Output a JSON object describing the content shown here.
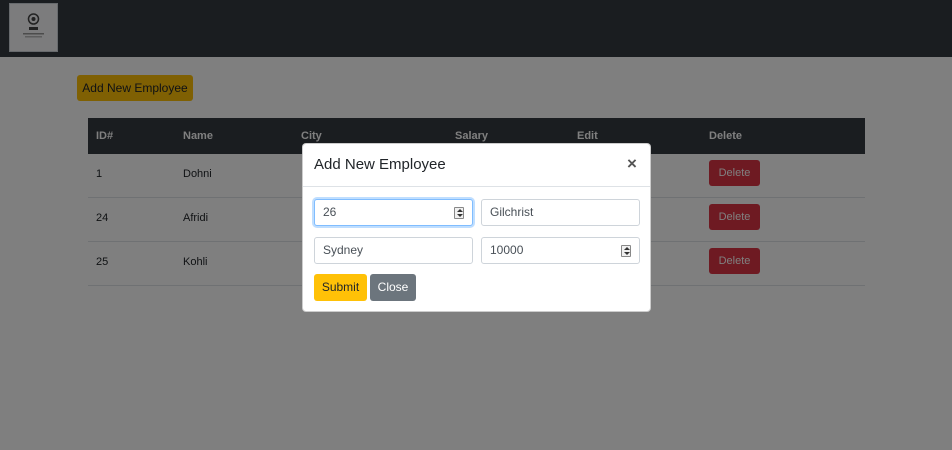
{
  "navbar": {
    "logo_icon": "company-logo"
  },
  "main": {
    "add_button_label": "Add New Employee",
    "table": {
      "headers": {
        "id": "ID#",
        "name": "Name",
        "city": "City",
        "salary": "Salary",
        "edit": "Edit",
        "delete": "Delete"
      },
      "rows": [
        {
          "id": "1",
          "name": "Dohni",
          "delete_label": "Delete"
        },
        {
          "id": "24",
          "name": "Afridi",
          "delete_label": "Delete"
        },
        {
          "id": "25",
          "name": "Kohli",
          "delete_label": "Delete"
        }
      ]
    }
  },
  "modal": {
    "title": "Add New Employee",
    "close_icon": "×",
    "fields": {
      "id_value": "26",
      "name_value": "Gilchrist",
      "city_value": "Sydney",
      "salary_value": "10000"
    },
    "submit_label": "Submit",
    "close_label": "Close"
  },
  "colors": {
    "navbar": "#343a40",
    "warning": "#ffc107",
    "danger": "#dc3545",
    "secondary": "#6c757d"
  }
}
